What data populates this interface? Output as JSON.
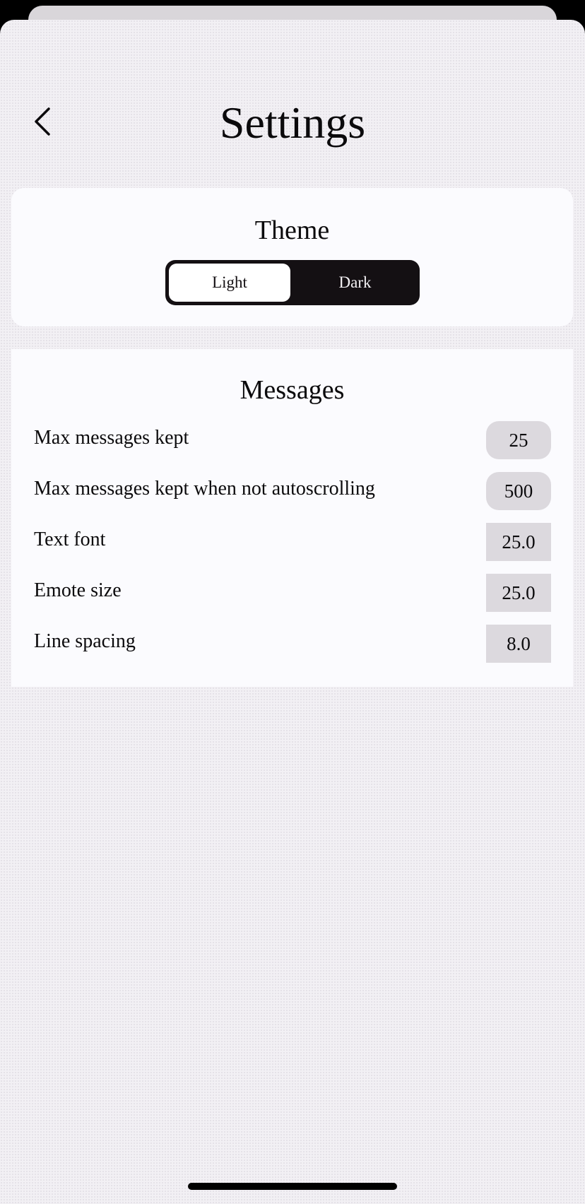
{
  "header": {
    "title": "Settings",
    "back_icon": "chevron-left-icon"
  },
  "theme": {
    "title": "Theme",
    "options": [
      "Light",
      "Dark"
    ],
    "selected": "Light"
  },
  "messages": {
    "title": "Messages",
    "rows": [
      {
        "label": "Max messages kept",
        "value": "25"
      },
      {
        "label": "Max messages kept when not autoscrolling",
        "value": "500"
      },
      {
        "label": "Text font",
        "value": "25.0"
      },
      {
        "label": "Emote size",
        "value": "25.0"
      },
      {
        "label": "Line spacing",
        "value": "8.0"
      }
    ]
  },
  "colors": {
    "background": "#f2f0f4",
    "card": "#fbfbfe",
    "text": "#0b0a0c",
    "segment_dark": "#141013",
    "field": "#dcd9de"
  }
}
